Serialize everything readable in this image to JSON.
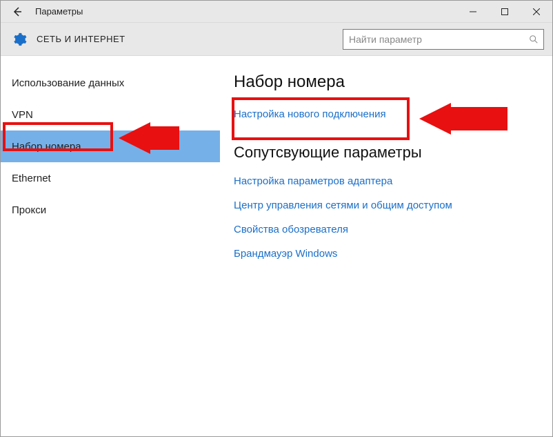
{
  "window": {
    "title": "Параметры"
  },
  "header": {
    "section": "СЕТЬ И ИНТЕРНЕТ",
    "search_placeholder": "Найти параметр"
  },
  "sidebar": {
    "items": [
      {
        "label": "Использование данных",
        "selected": false
      },
      {
        "label": "VPN",
        "selected": false
      },
      {
        "label": "Набор номера",
        "selected": true
      },
      {
        "label": "Ethernet",
        "selected": false
      },
      {
        "label": "Прокси",
        "selected": false
      }
    ]
  },
  "content": {
    "heading": "Набор номера",
    "primary_link": "Настройка нового подключения",
    "related_heading": "Сопутсвующие параметры",
    "related_links": [
      "Настройка параметров адаптера",
      "Центр управления сетями и общим доступом",
      "Свойства обозревателя",
      "Брандмауэр Windows"
    ]
  }
}
